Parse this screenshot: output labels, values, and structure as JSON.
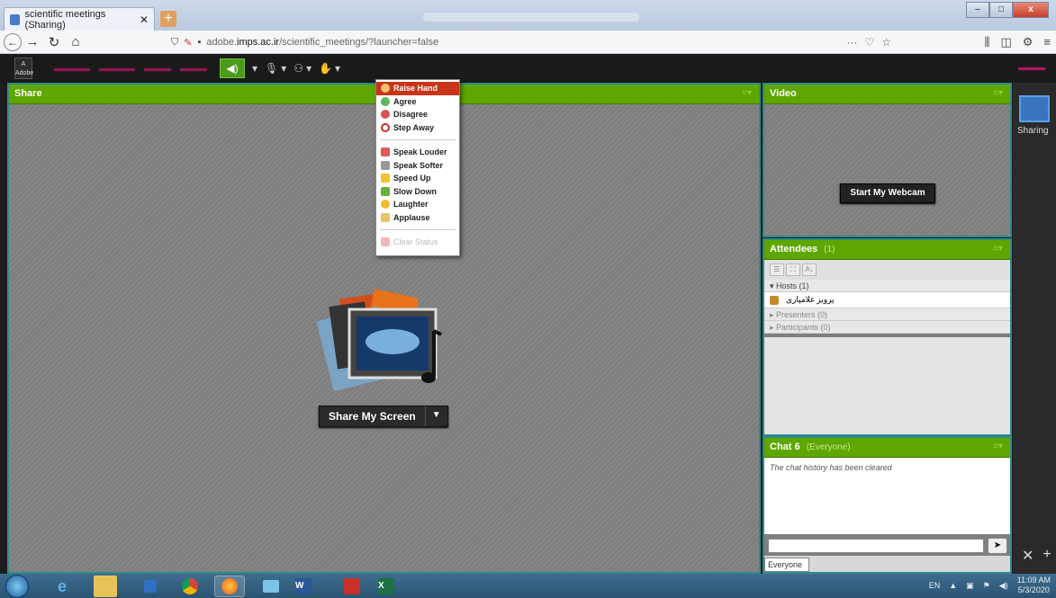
{
  "browser": {
    "tab_title": "scientific meetings (Sharing)",
    "tab_close": "✕",
    "new_tab": "+",
    "url_prefix": "adobe.",
    "url_domain": "imps.ac.ir",
    "url_path": "/scientific_meetings/?launcher=false",
    "url_more": "···",
    "win_min": "–",
    "win_max": "□",
    "win_close": "x"
  },
  "app": {
    "logo_text": "Adobe",
    "status_items": [
      "Raise Hand",
      "Agree",
      "Disagree",
      "Step Away"
    ],
    "feedback_items": [
      "Speak Louder",
      "Speak Softer",
      "Speed Up",
      "Slow Down",
      "Laughter",
      "Applause"
    ],
    "clear_status": "Clear Status"
  },
  "share_pod": {
    "title": "Share",
    "button": "Share My Screen"
  },
  "video_pod": {
    "title": "Video",
    "button": "Start My Webcam"
  },
  "attendees_pod": {
    "title": "Attendees",
    "count": "(1)",
    "hosts": "Hosts (1)",
    "host_name": "پرویز غلامپاری",
    "presenters": "Presenters (0)",
    "participants": "Participants (0)"
  },
  "chat_pod": {
    "title": "Chat 6",
    "scope": "(Everyone)",
    "history_msg": "The chat history has been cleared",
    "tab_label": "Everyone"
  },
  "right_bar": {
    "layout_label": "Sharing"
  },
  "taskbar": {
    "lang": "EN",
    "time": "11:09 AM",
    "date": "5/3/2020"
  }
}
